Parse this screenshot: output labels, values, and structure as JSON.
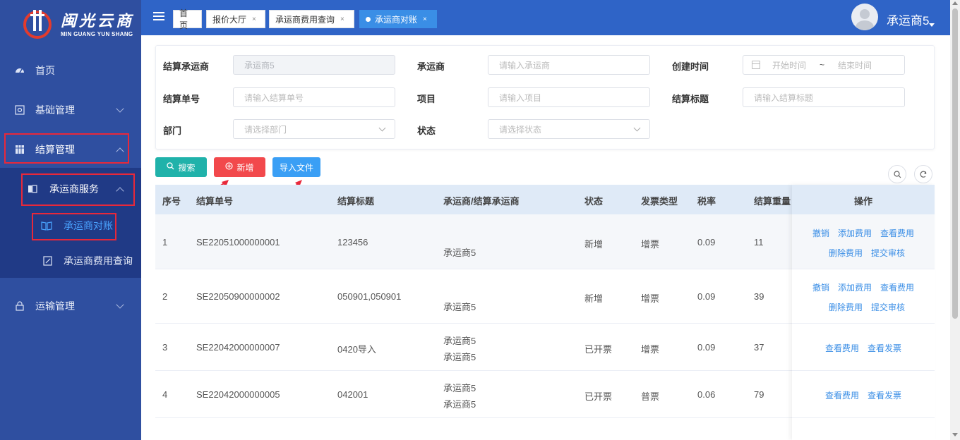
{
  "brand": {
    "name_cn": "闽光云商",
    "name_en": "MIN GUANG YUN SHANG"
  },
  "sidebar": {
    "items": [
      {
        "label": "首页",
        "icon": "dashboard-icon"
      },
      {
        "label": "基础管理",
        "icon": "settings-box-icon"
      },
      {
        "label": "结算管理",
        "icon": "grid-icon"
      },
      {
        "label": "承运商服务",
        "icon": "book-icon"
      },
      {
        "label": "承运商对账",
        "icon": "open-book-icon"
      },
      {
        "label": "承运商费用查询",
        "icon": "edit-doc-icon"
      },
      {
        "label": "运输管理",
        "icon": "lock-icon"
      }
    ]
  },
  "tabs": [
    {
      "label": "首页"
    },
    {
      "label": "报价大厅"
    },
    {
      "label": "承运商费用查询"
    },
    {
      "label": "承运商对账"
    }
  ],
  "user": {
    "name": "承运商5"
  },
  "filters": {
    "settle_carrier": {
      "label": "结算承运商",
      "value": "承运商5"
    },
    "carrier": {
      "label": "承运商",
      "placeholder": "请输入承运商"
    },
    "created_time": {
      "label": "创建时间",
      "start": "开始时间",
      "sep": "~",
      "end": "结束时间"
    },
    "settle_no": {
      "label": "结算单号",
      "placeholder": "请输入结算单号"
    },
    "project": {
      "label": "项目",
      "placeholder": "请输入项目"
    },
    "settle_title": {
      "label": "结算标题",
      "placeholder": "请输入结算标题"
    },
    "department": {
      "label": "部门",
      "placeholder": "请选择部门"
    },
    "status": {
      "label": "状态",
      "placeholder": "请选择状态"
    }
  },
  "actions": {
    "search": "搜索",
    "add": "新增",
    "import": "导入文件"
  },
  "table": {
    "headers": [
      "序号",
      "结算单号",
      "结算标题",
      "承运商/结算承运商",
      "状态",
      "发票类型",
      "税率",
      "结算重量",
      "操作"
    ],
    "rows": [
      {
        "idx": "1",
        "no": "SE22051000000001",
        "title": "123456",
        "carrier1": "",
        "carrier2": "承运商5",
        "status": "新增",
        "invoice": "增票",
        "tax": "0.09",
        "weight": "11",
        "ops1": [
          "撤销",
          "添加费用",
          "查看费用"
        ],
        "ops2": [
          "删除费用",
          "提交审核"
        ]
      },
      {
        "idx": "2",
        "no": "SE22050900000002",
        "title": "050901,050901",
        "carrier1": "",
        "carrier2": "承运商5",
        "status": "新增",
        "invoice": "增票",
        "tax": "0.09",
        "weight": "39",
        "ops1": [
          "撤销",
          "添加费用",
          "查看费用"
        ],
        "ops2": [
          "删除费用",
          "提交审核"
        ]
      },
      {
        "idx": "3",
        "no": "SE22042000000007",
        "title": "0420导入",
        "carrier1": "承运商5",
        "carrier2": "承运商5",
        "status": "已开票",
        "invoice": "增票",
        "tax": "0.09",
        "weight": "37",
        "ops1": [
          "查看费用",
          "查看发票"
        ],
        "ops2": []
      },
      {
        "idx": "4",
        "no": "SE22042000000005",
        "title": "042001",
        "carrier1": "承运商5",
        "carrier2": "承运商5",
        "status": "已开票",
        "invoice": "普票",
        "tax": "0.06",
        "weight": "79",
        "ops1": [
          "查看费用",
          "查看发票"
        ],
        "ops2": []
      }
    ]
  },
  "colors": {
    "sidebar": "#2f4fa0",
    "topbar": "#2f64c7",
    "search": "#20b2aa",
    "add": "#f2494c",
    "import": "#3a9ff5",
    "highlight": "#e8283a",
    "link": "#3a8ee6"
  }
}
